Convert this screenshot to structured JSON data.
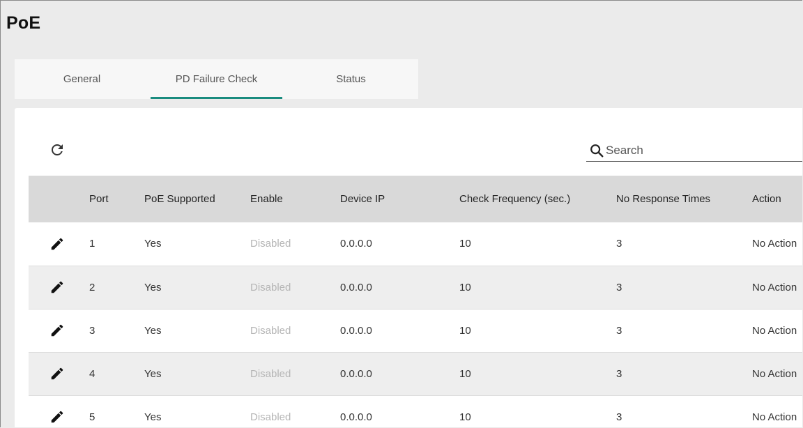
{
  "page": {
    "title": "PoE"
  },
  "tabs": [
    {
      "label": "General",
      "active": false
    },
    {
      "label": "PD Failure Check",
      "active": true
    },
    {
      "label": "Status",
      "active": false
    }
  ],
  "toolbar": {
    "refresh_icon": "refresh-icon",
    "search_icon": "search-icon",
    "search_placeholder": "Search"
  },
  "colors": {
    "accent": "#1a8c7f",
    "header_bg": "#d9d9d9",
    "disabled_text": "#b5b5b5"
  },
  "table": {
    "columns": [
      "Port",
      "PoE Supported",
      "Enable",
      "Device IP",
      "Check Frequency (sec.)",
      "No Response Times",
      "Action"
    ],
    "row_icon": "edit-pencil-icon",
    "rows": [
      {
        "port": "1",
        "poe_supported": "Yes",
        "enable": "Disabled",
        "device_ip": "0.0.0.0",
        "check_frequency": "10",
        "no_response_times": "3",
        "action": "No Action"
      },
      {
        "port": "2",
        "poe_supported": "Yes",
        "enable": "Disabled",
        "device_ip": "0.0.0.0",
        "check_frequency": "10",
        "no_response_times": "3",
        "action": "No Action"
      },
      {
        "port": "3",
        "poe_supported": "Yes",
        "enable": "Disabled",
        "device_ip": "0.0.0.0",
        "check_frequency": "10",
        "no_response_times": "3",
        "action": "No Action"
      },
      {
        "port": "4",
        "poe_supported": "Yes",
        "enable": "Disabled",
        "device_ip": "0.0.0.0",
        "check_frequency": "10",
        "no_response_times": "3",
        "action": "No Action"
      },
      {
        "port": "5",
        "poe_supported": "Yes",
        "enable": "Disabled",
        "device_ip": "0.0.0.0",
        "check_frequency": "10",
        "no_response_times": "3",
        "action": "No Action"
      }
    ]
  }
}
